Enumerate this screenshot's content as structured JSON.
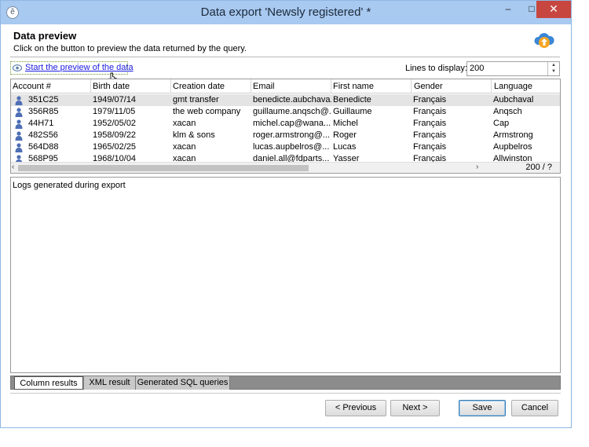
{
  "window": {
    "title": "Data export 'Newsly registered' *",
    "controls": {
      "minimize": "–",
      "maximize": "□",
      "close": "✕"
    }
  },
  "header": {
    "title": "Data preview",
    "subtitle": "Click on the button to preview the data returned by the query.",
    "icon": "cloud-upload-icon"
  },
  "preview": {
    "link_label": "Start the preview of the data",
    "lines_label": "Lines to display:",
    "lines_value": "200"
  },
  "grid": {
    "columns": [
      "Account #",
      "Birth date",
      "Creation date",
      "Email",
      "First name",
      "Gender",
      "Language"
    ],
    "rows": [
      {
        "account": "351C25",
        "birth": "1949/07/14",
        "created": "gmt transfer",
        "email": "benedicte.aubchava...",
        "first": "Benedicte",
        "gender": "Français",
        "lang": "Aubchaval"
      },
      {
        "account": "356R85",
        "birth": "1979/11/05",
        "created": "the web company",
        "email": "guillaume.anqsch@...",
        "first": "Guillaume",
        "gender": "Français",
        "lang": "Anqsch"
      },
      {
        "account": "44H71",
        "birth": "1952/05/02",
        "created": "xacan",
        "email": "michel.cap@wana...",
        "first": "Michel",
        "gender": "Français",
        "lang": "Cap"
      },
      {
        "account": "482S56",
        "birth": "1958/09/22",
        "created": "klm & sons",
        "email": "roger.armstrong@...",
        "first": "Roger",
        "gender": "Français",
        "lang": "Armstrong"
      },
      {
        "account": "564D88",
        "birth": "1965/02/25",
        "created": "xacan",
        "email": "lucas.aupbelros@...",
        "first": "Lucas",
        "gender": "Français",
        "lang": "Aupbelros"
      },
      {
        "account": "568P95",
        "birth": "1968/10/04",
        "created": "xacan",
        "email": "daniel.all@fdparts...",
        "first": "Yasser",
        "gender": "Français",
        "lang": "Allwinston"
      }
    ],
    "count": "200 / ?"
  },
  "logs": {
    "label": "Logs generated during export"
  },
  "tabs": [
    "Column results",
    "XML result",
    "Generated SQL queries"
  ],
  "buttons": {
    "previous": "< Previous",
    "next": "Next >",
    "save": "Save",
    "cancel": "Cancel"
  },
  "colors": {
    "titlebar": "#a8c9f0",
    "close": "#c7463f",
    "link": "#1b1be0",
    "person_icon": "#4e6fb5"
  }
}
